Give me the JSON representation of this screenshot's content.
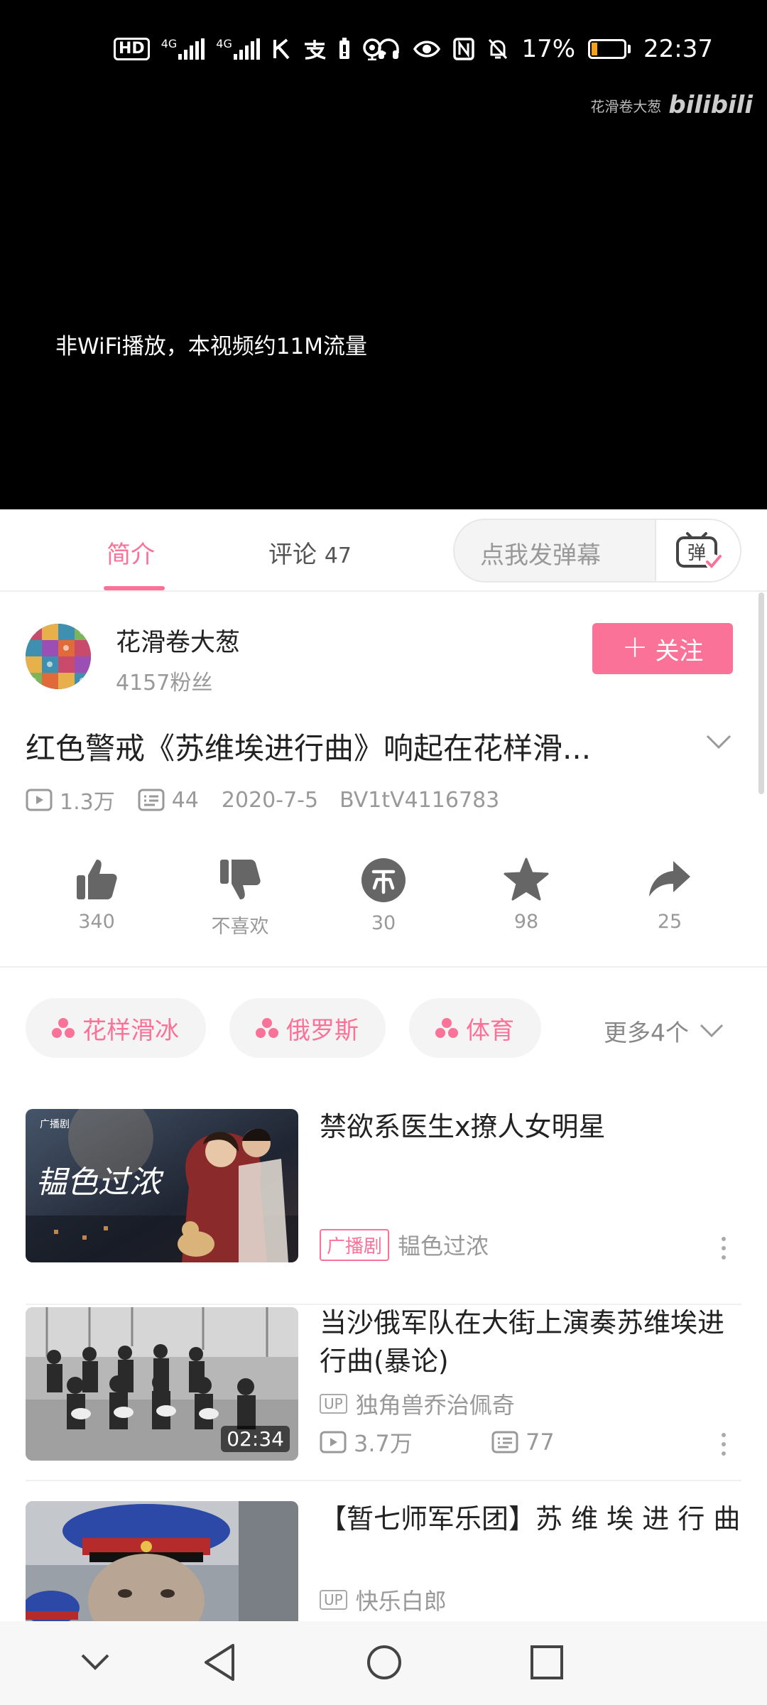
{
  "status_bar": {
    "hd_label": "HD",
    "sim1_tech": "4G",
    "sim2_tech": "4G",
    "battery_percent": "17%",
    "battery_level": 0.17,
    "time": "22:37",
    "icons": [
      "hd-icon",
      "signal-icon",
      "signal-icon",
      "k-app-icon",
      "alipay-icon",
      "battery-saver-icon",
      "hotspot-icon",
      "headset-icon",
      "eye-comfort-icon",
      "nfc-icon",
      "mute-icon",
      "battery-icon"
    ]
  },
  "player": {
    "watermark_author": "花滑卷大葱",
    "watermark_brand": "bilibili",
    "data_notice": "非WiFi播放，本视频约11M流量"
  },
  "tabs": {
    "intro": "简介",
    "comments_label": "评论",
    "comments_count": "47",
    "danmaku_placeholder": "点我发弹幕",
    "danmaku_button": "弹"
  },
  "uploader": {
    "name": "花滑卷大葱",
    "fans": "4157粉丝",
    "follow_label": "关注"
  },
  "video": {
    "title": "红色警戒《苏维埃进行曲》响起在花样滑...",
    "views": "1.3万",
    "danmaku_count": "44",
    "date": "2020-7-5",
    "bvid": "BV1tV4116783"
  },
  "actions": [
    {
      "name": "like",
      "icon": "thumbs-up-icon",
      "label": "340"
    },
    {
      "name": "dislike",
      "icon": "thumbs-down-icon",
      "label": "不喜欢"
    },
    {
      "name": "coin",
      "icon": "coin-icon",
      "label": "30"
    },
    {
      "name": "favorite",
      "icon": "star-icon",
      "label": "98"
    },
    {
      "name": "share",
      "icon": "share-icon",
      "label": "25"
    }
  ],
  "tags": [
    "花样滑冰",
    "俄罗斯",
    "体育"
  ],
  "more_tags": "更多4个",
  "recommendations": [
    {
      "title": "禁欲系医生x撩人女明星",
      "badge": "广播剧",
      "author": "韫色过浓"
    },
    {
      "title": "当沙俄军队在大街上演奏苏维埃进行曲(暴论)",
      "up_label": "UP",
      "author": "独角兽乔治佩奇",
      "duration": "02:34",
      "views": "3.7万",
      "danmaku": "77"
    },
    {
      "title": "【暂七师军乐团】苏 维 埃 进 行 曲",
      "up_label": "UP",
      "author": "快乐白郎"
    }
  ],
  "colors": {
    "accent": "#fb7299",
    "video_bg": "#000000",
    "secondary_text": "#999999",
    "battery_fill": "#f6a01a"
  }
}
